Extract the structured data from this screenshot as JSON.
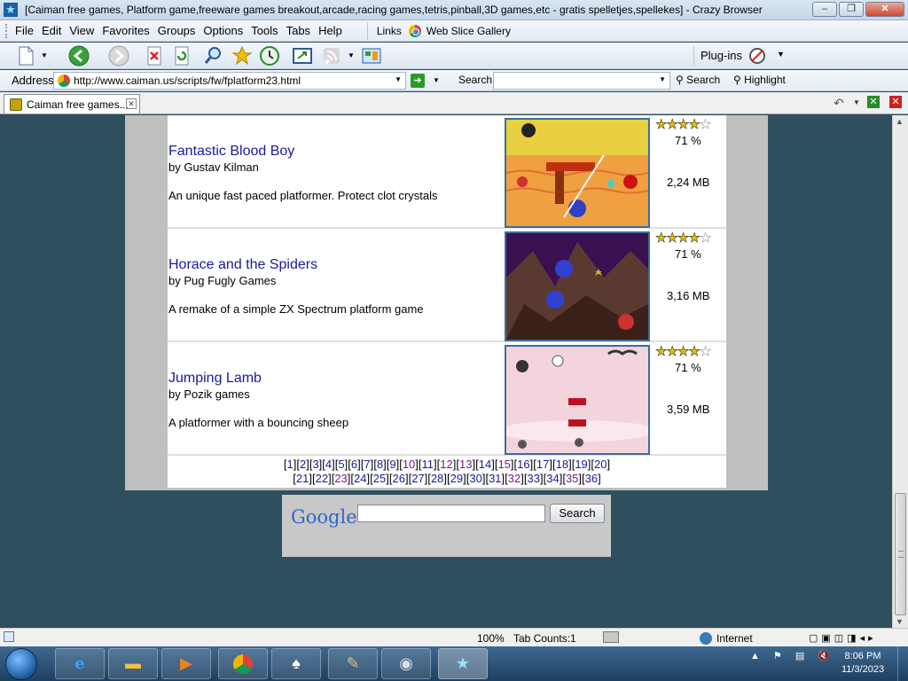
{
  "window": {
    "title": "[Caiman free games, Platform game,freeware games breakout,arcade,racing games,tetris,pinball,3D games,etc - gratis spelletjes,spellekes] - Crazy Browser",
    "min": "–",
    "max": "❐",
    "close": "✕"
  },
  "menubar": {
    "items": [
      "File",
      "Edit",
      "View",
      "Favorites",
      "Groups",
      "Options",
      "Tools",
      "Tabs",
      "Help"
    ],
    "links_label": "Links",
    "web_slice": "Web Slice Gallery"
  },
  "toolbar": {
    "plugins_label": "Plug-ins"
  },
  "address": {
    "label": "Address",
    "url": "http://www.caiman.us/scripts/fw/fplatform23.html",
    "search_label": "Search",
    "search_button": "Search",
    "highlight_button": "Highlight"
  },
  "tabs": [
    {
      "label": "Caiman free games..."
    }
  ],
  "games": [
    {
      "title": "Fantastic Blood Boy",
      "author": "by Gustav Kilman",
      "description": "An unique fast paced platformer. Protect clot crystals",
      "rating": "71 %",
      "rating_stars": 3.5,
      "size": "2,24 MB"
    },
    {
      "title": "Horace and the Spiders",
      "author": "by Pug Fugly Games",
      "description": "A remake of a simple ZX Spectrum platform game",
      "rating": "71 %",
      "rating_stars": 3.5,
      "size": "3,16 MB"
    },
    {
      "title": "Jumping Lamb",
      "author": "by Pozik games",
      "description": "A platformer with a bouncing sheep",
      "rating": "71 %",
      "rating_stars": 3.5,
      "size": "3,59 MB"
    }
  ],
  "pager": {
    "line1": [
      "1",
      "2",
      "3",
      "4",
      "5",
      "6",
      "7",
      "8",
      "9",
      "10",
      "11",
      "12",
      "13",
      "14",
      "15",
      "16",
      "17",
      "18",
      "19",
      "20"
    ],
    "line2": [
      "21",
      "22",
      "23",
      "24",
      "25",
      "26",
      "27",
      "28",
      "29",
      "30",
      "31",
      "32",
      "33",
      "34",
      "35",
      "36"
    ],
    "visited": [
      "10",
      "12",
      "13",
      "15",
      "23",
      "32",
      "35"
    ]
  },
  "google": {
    "logo": "Google",
    "button": "Search"
  },
  "status": {
    "zoom": "100%",
    "tab_count": "Tab Counts:1",
    "zone": "Internet"
  },
  "taskbar": {
    "time": "8:06 PM",
    "date": "11/3/2023"
  },
  "colors": {
    "page_bg": "#2f4f5f",
    "link": "#1a1a9a",
    "visited_link": "#7a1a8a",
    "star": "#e8c000"
  }
}
